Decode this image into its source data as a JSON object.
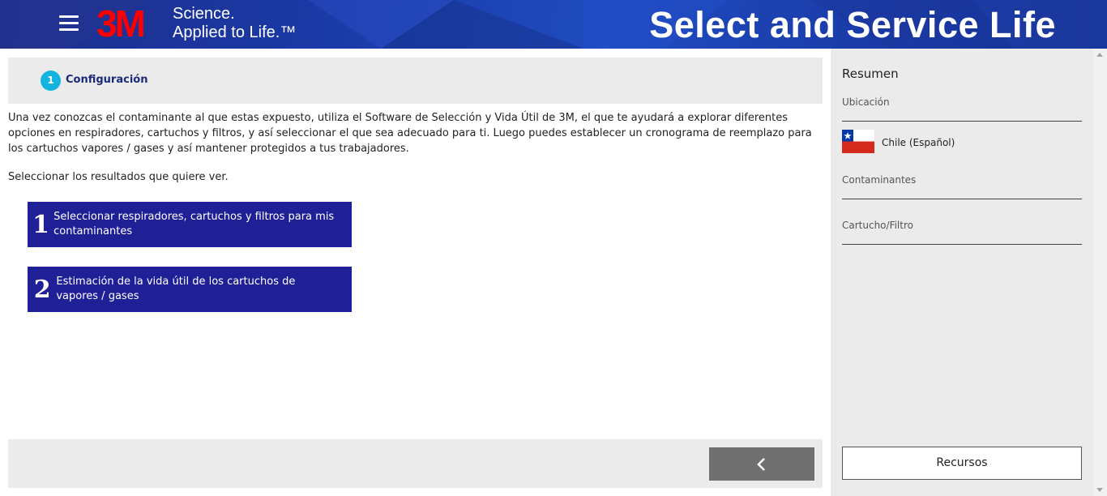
{
  "header": {
    "brand": "3M",
    "tagline_line1": "Science.",
    "tagline_line2": "Applied to Life.™",
    "app_title": "Select and Service Life"
  },
  "main": {
    "step": {
      "number": "1",
      "label": "Configuración"
    },
    "intro_text": "Una vez conozcas el contaminante al que estas expuesto, utiliza el Software de Selección y Vida Útil de 3M, el que te ayudará a explorar diferentes opciones en respiradores, cartuchos y filtros, y así seleccionar el que sea adecuado para ti. Luego puedes establecer un cronograma de reemplazo para los cartuchos vapores / gases y así mantener protegidos a tus trabajadores.",
    "select_prompt": "Seleccionar los resultados que quiere ver.",
    "options": [
      {
        "number": "1",
        "label": "Seleccionar respiradores, cartuchos y filtros para mis contaminantes"
      },
      {
        "number": "2",
        "label": "Estimación de la vida útil de los cartuchos de vapores / gases"
      }
    ]
  },
  "sidebar": {
    "title": "Resumen",
    "location_label": "Ubicación",
    "country": "Chile (Español)",
    "contaminants_label": "Contaminantes",
    "cartridge_label": "Cartucho/Filtro",
    "resources_button": "Recursos"
  },
  "icons": {
    "menu": "hamburger-icon",
    "back": "chevron-left-icon",
    "flag": "chile-flag-icon"
  },
  "colors": {
    "header_blue": "#1a3aa6",
    "brand_red": "#ff0000",
    "option_blue": "#1f1f96",
    "step_badge": "#14b4e0",
    "back_button": "#707070"
  }
}
